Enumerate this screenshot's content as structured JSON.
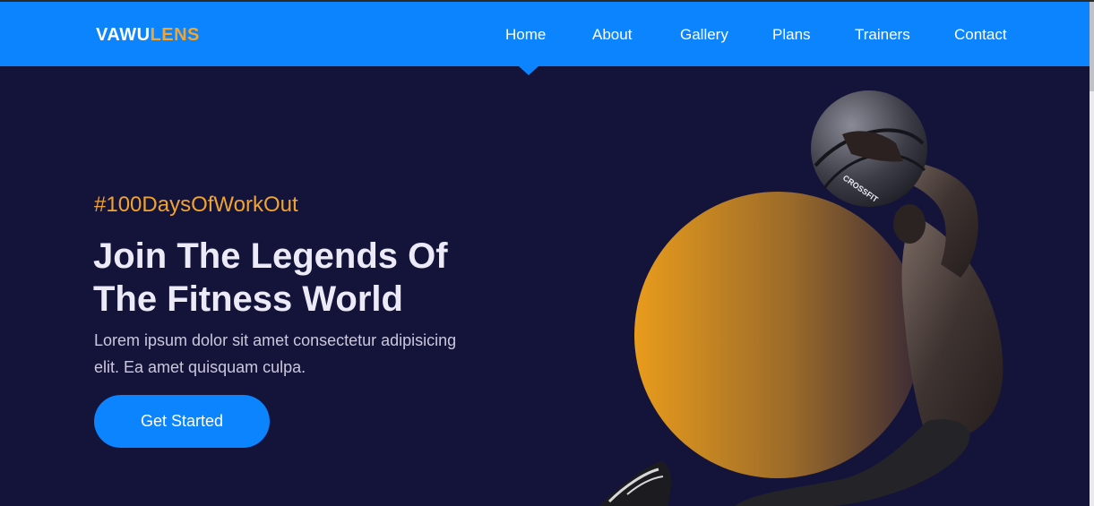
{
  "brand": {
    "prefix": "VAWU",
    "accent": "LENS"
  },
  "nav": {
    "items": [
      {
        "label": "Home"
      },
      {
        "label": "About"
      },
      {
        "label": "Gallery"
      },
      {
        "label": "Plans"
      },
      {
        "label": "Trainers"
      },
      {
        "label": "Contact"
      }
    ]
  },
  "hero": {
    "hashtag": "#100DaysOfWorkOut",
    "title_line1": "Join The Legends Of",
    "title_line2": "The Fitness World",
    "description_line1": "Lorem ipsum dolor sit amet consectetur adipisicing",
    "description_line2": "elit. Ea amet quisquam culpa.",
    "cta_label": "Get Started",
    "ball_text": "CROSSFIT"
  },
  "colors": {
    "nav_bg": "#0b84fd",
    "page_bg": "#14143b",
    "accent": "#f0a331"
  }
}
